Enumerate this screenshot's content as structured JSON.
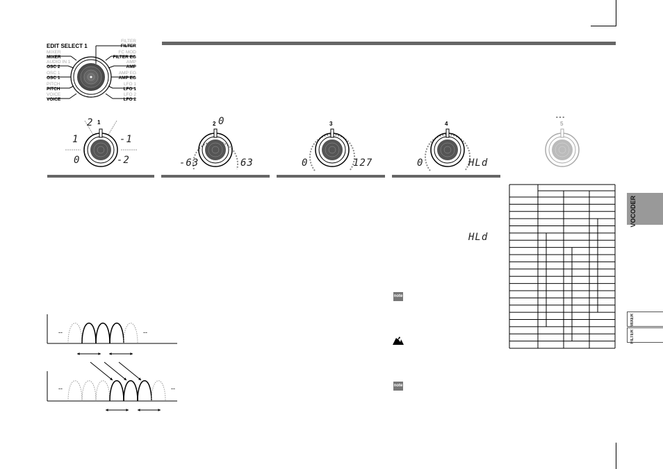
{
  "page": {
    "top_rule_color": "#666666",
    "accent_gray": "#999999"
  },
  "edit_select": {
    "title": "EDIT SELECT 1",
    "left_labels": [
      {
        "top": "MIXER",
        "bottom": "MIXER"
      },
      {
        "top": "AUDIO IN 1",
        "bottom": "OSC 2"
      },
      {
        "top": "OSC 1",
        "bottom": "OSC 1"
      },
      {
        "top": "PITCH",
        "bottom": "PITCH"
      },
      {
        "top": "VOICE",
        "bottom": "VOICE"
      }
    ],
    "right_labels": [
      {
        "top": "FILTER",
        "bottom": "FILTER"
      },
      {
        "top": "FC MOD",
        "bottom": "FILTER EG"
      },
      {
        "top": "AMP",
        "bottom": "AMP"
      },
      {
        "top": "AMP EG",
        "bottom": "AMP EG"
      },
      {
        "top": "LFO 1",
        "bottom": "LFO 1"
      },
      {
        "top": "LFO 2",
        "bottom": "LFO 2"
      }
    ]
  },
  "knobs": [
    {
      "number": "1",
      "labels": {
        "top_left": "2",
        "left": "1",
        "bottom_left": "0",
        "top_right": "-1",
        "bottom_right": "-2"
      }
    },
    {
      "number": "2",
      "labels": {
        "top": "0",
        "min": "-63",
        "max": "63"
      }
    },
    {
      "number": "3",
      "labels": {
        "min": "0",
        "max": "127"
      }
    },
    {
      "number": "4",
      "labels": {
        "min": "0",
        "max": "HLd"
      }
    },
    {
      "number": "5",
      "labels": {
        "top": "---"
      },
      "disabled": true
    }
  ],
  "body": {
    "inline_display": "HLd",
    "note_icon_label": "note",
    "caution_icon": "caution-icon"
  },
  "side_tabs": {
    "active": "VOCODER",
    "others": [
      "MIXER",
      "FILTER"
    ]
  },
  "table": {
    "rows": 23,
    "columns": 4
  }
}
